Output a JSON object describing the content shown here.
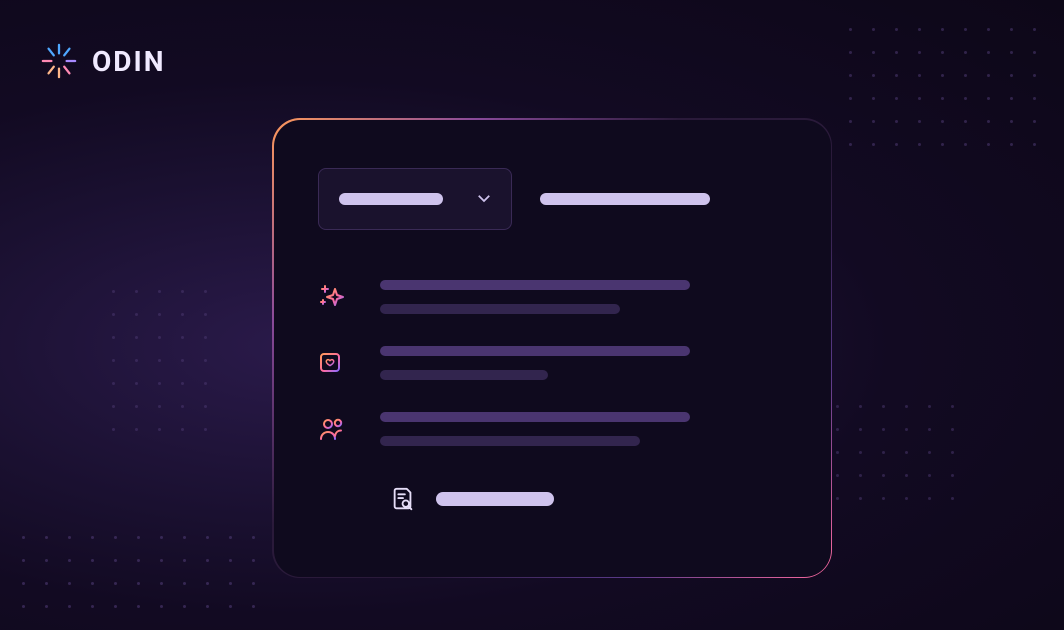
{
  "brand": {
    "name": "ODIN"
  },
  "card": {
    "dropdown": {
      "label": "",
      "open": false
    },
    "header_label": "",
    "items": [
      {
        "icon": "sparkle-icon",
        "title": "",
        "subtitle": ""
      },
      {
        "icon": "calendar-heart-icon",
        "title": "",
        "subtitle": ""
      },
      {
        "icon": "users-icon",
        "title": "",
        "subtitle": ""
      }
    ],
    "footer": {
      "icon": "document-search-icon",
      "label": ""
    }
  },
  "colors": {
    "background": "#120a22",
    "card_bg": "#0f0a1e",
    "accent_gradient": [
      "#ff9a5a",
      "#ff6aa0",
      "#8a6aff"
    ],
    "skeleton_light": "#cfc3ed",
    "skeleton_mid": "#4a3570",
    "skeleton_dark": "#32254e"
  }
}
